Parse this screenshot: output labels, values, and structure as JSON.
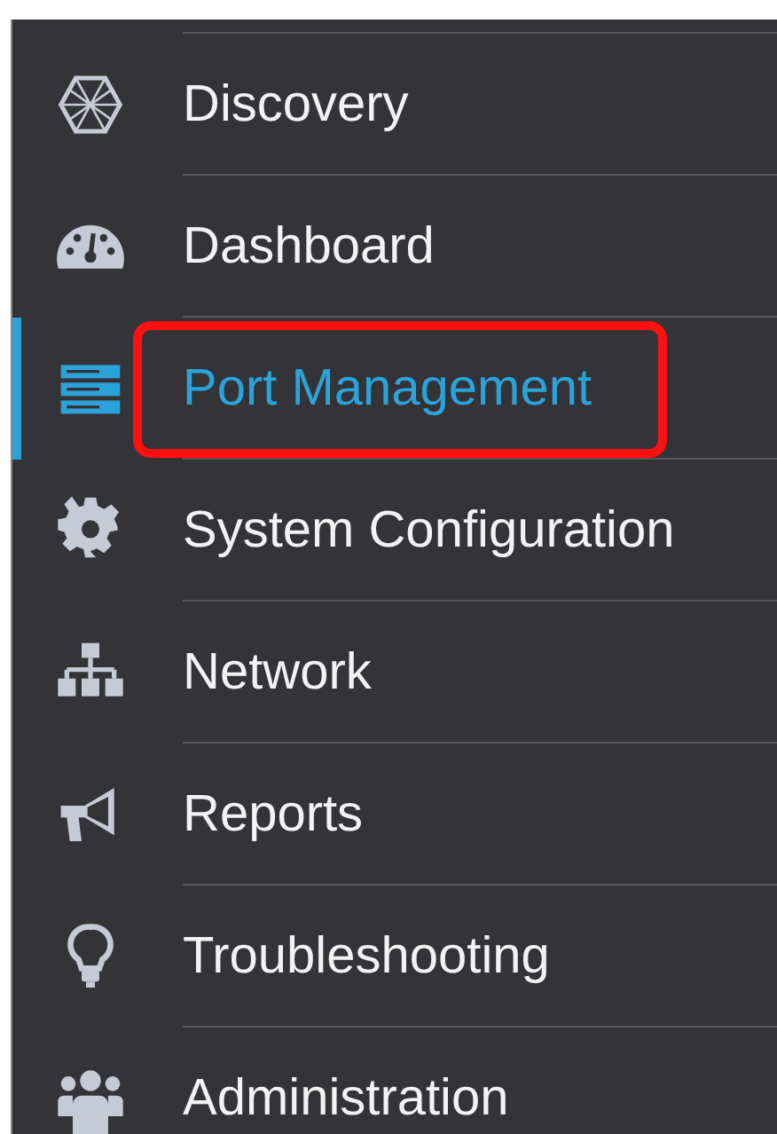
{
  "sidebar": {
    "items": [
      {
        "label": "Discovery",
        "selected": false,
        "highlighted": false
      },
      {
        "label": "Dashboard",
        "selected": false,
        "highlighted": false
      },
      {
        "label": "Port Management",
        "selected": true,
        "highlighted": true
      },
      {
        "label": "System Configuration",
        "selected": false,
        "highlighted": false
      },
      {
        "label": "Network",
        "selected": false,
        "highlighted": false
      },
      {
        "label": "Reports",
        "selected": false,
        "highlighted": false
      },
      {
        "label": "Troubleshooting",
        "selected": false,
        "highlighted": false
      },
      {
        "label": "Administration",
        "selected": false,
        "highlighted": false
      }
    ]
  }
}
